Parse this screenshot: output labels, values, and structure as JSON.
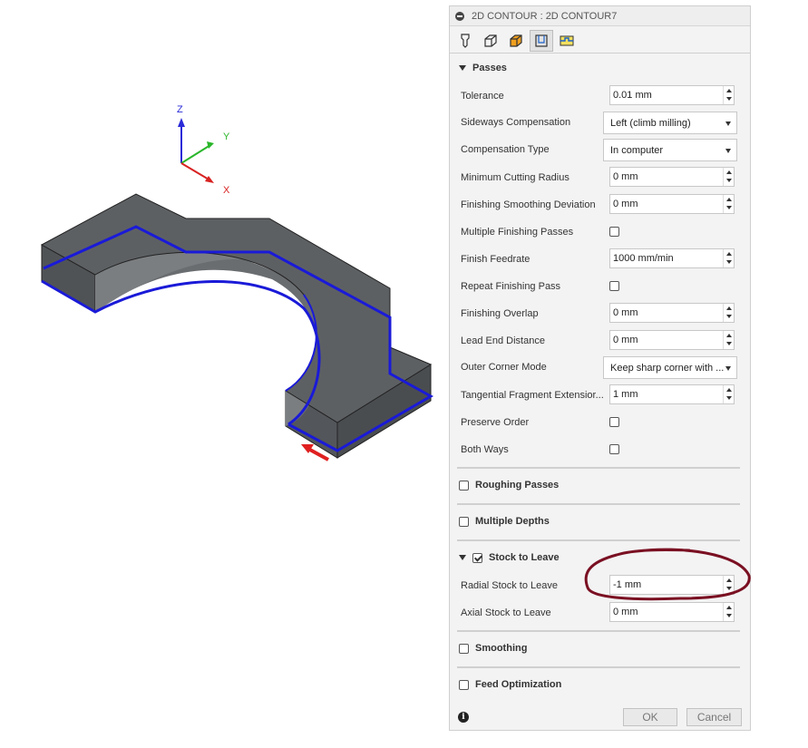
{
  "viewport": {
    "axes": {
      "z_label": "Z",
      "y_label": "Y",
      "x_label": "X"
    }
  },
  "dialog": {
    "title": "2D CONTOUR : 2D CONTOUR7",
    "tabs": [
      {
        "icon": "tool-icon"
      },
      {
        "icon": "geometry-icon"
      },
      {
        "icon": "heights-icon"
      },
      {
        "icon": "passes-icon"
      },
      {
        "icon": "linking-icon"
      }
    ],
    "active_tab": 3,
    "passes": {
      "header": "Passes",
      "tolerance": {
        "label": "Tolerance",
        "value": "0.01 mm"
      },
      "sideways_compensation": {
        "label": "Sideways Compensation",
        "value": "Left (climb milling)"
      },
      "compensation_type": {
        "label": "Compensation Type",
        "value": "In computer"
      },
      "min_cutting_radius": {
        "label": "Minimum Cutting Radius",
        "value": "0 mm"
      },
      "finishing_smoothing_deviation": {
        "label": "Finishing Smoothing Deviation",
        "value": "0 mm"
      },
      "multiple_finishing_passes": {
        "label": "Multiple Finishing Passes",
        "checked": false
      },
      "finish_feedrate": {
        "label": "Finish Feedrate",
        "value": "1000 mm/min"
      },
      "repeat_finishing_pass": {
        "label": "Repeat Finishing Pass",
        "checked": false
      },
      "finishing_overlap": {
        "label": "Finishing Overlap",
        "value": "0 mm"
      },
      "lead_end_distance": {
        "label": "Lead End Distance",
        "value": "0 mm"
      },
      "outer_corner_mode": {
        "label": "Outer Corner Mode",
        "value": "Keep sharp corner with ..."
      },
      "tangential_fragment_extension": {
        "label": "Tangential Fragment Extensior...",
        "value": "1 mm"
      },
      "preserve_order": {
        "label": "Preserve Order",
        "checked": false
      },
      "both_ways": {
        "label": "Both Ways",
        "checked": false
      }
    },
    "roughing_passes": {
      "label": "Roughing Passes",
      "checked": false
    },
    "multiple_depths": {
      "label": "Multiple Depths",
      "checked": false
    },
    "stock_to_leave": {
      "label": "Stock to Leave",
      "checked": true,
      "radial": {
        "label": "Radial Stock to Leave",
        "value": "-1 mm"
      },
      "axial": {
        "label": "Axial Stock to Leave",
        "value": "0 mm"
      }
    },
    "smoothing": {
      "label": "Smoothing",
      "checked": false
    },
    "feed_optimization": {
      "label": "Feed Optimization",
      "checked": false
    },
    "ok_label": "OK",
    "cancel_label": "Cancel",
    "annotation_color": "#7a1022"
  }
}
